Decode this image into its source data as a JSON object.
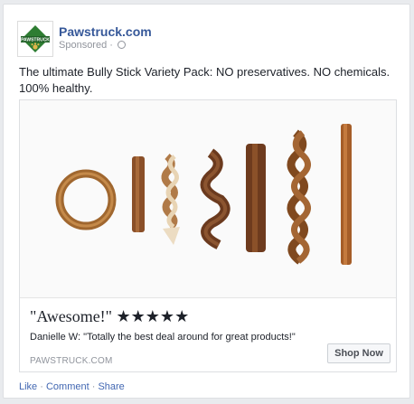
{
  "post": {
    "page_name": "Pawstruck.com",
    "sponsored": "Sponsored",
    "dot": "·",
    "text": "The ultimate Bully Stick Variety Pack: NO preservatives. NO chemicals. 100% healthy.",
    "logo_text": "PAWSTRUCK",
    "globe_icon": "globe-icon"
  },
  "link": {
    "title": "\"Awesome!\" ★★★★★",
    "description": "Danielle W: \"Totally the best deal around for great products!\"",
    "domain": "PAWSTRUCK.COM",
    "cta": "Shop Now"
  },
  "actions": {
    "like": "Like",
    "comment": "Comment",
    "share": "Share",
    "separator": " · "
  },
  "colors": {
    "link_blue": "#365899",
    "action_blue": "#4267b2",
    "logo_green": "#2e7d32",
    "logo_gold": "#e0b64c"
  }
}
